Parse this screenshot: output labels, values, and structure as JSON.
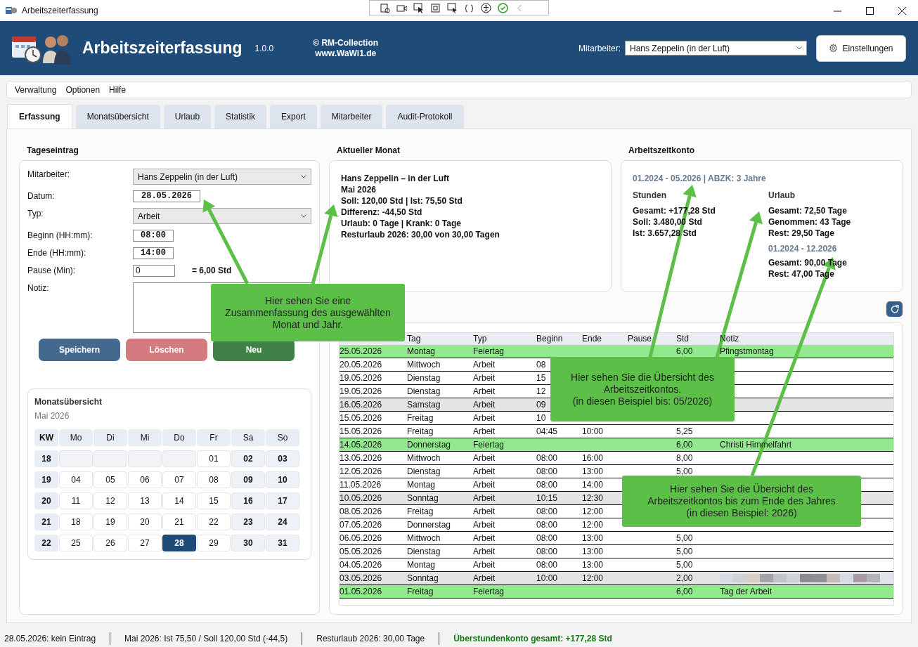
{
  "window": {
    "title": "Arbeitszeiterfassung"
  },
  "header": {
    "app_name": "Arbeitszeiterfassung",
    "version": "1.0.0",
    "copyright": "© RM-Collection",
    "website": "www.WaWi1.de",
    "employee_label": "Mitarbeiter:",
    "employee_value": "Hans Zeppelin (in der Luft)",
    "settings_button": "Einstellungen"
  },
  "menu": [
    "Verwaltung",
    "Optionen",
    "Hilfe"
  ],
  "tabs": [
    {
      "label": "Erfassung",
      "selected": true
    },
    {
      "label": "Monatsübersicht",
      "selected": false
    },
    {
      "label": "Urlaub",
      "selected": false
    },
    {
      "label": "Statistik",
      "selected": false
    },
    {
      "label": "Export",
      "selected": false
    },
    {
      "label": "Mitarbeiter",
      "selected": false
    },
    {
      "label": "Audit-Protokoll",
      "selected": false
    }
  ],
  "entry": {
    "title": "Tageseintrag",
    "fields": [
      {
        "kind": "select",
        "label": "Mitarbeiter:",
        "value": "Hans Zeppelin (in der Luft)"
      },
      {
        "kind": "date",
        "label": "Datum:",
        "value": "28.05.2026"
      },
      {
        "kind": "select",
        "label": "Typ:",
        "value": "Arbeit"
      },
      {
        "kind": "time",
        "label": "Beginn (HH:mm):",
        "value": "08:00"
      },
      {
        "kind": "time",
        "label": "Ende (HH:mm):",
        "value": "14:00"
      },
      {
        "kind": "number",
        "label": "Pause (Min):",
        "value": "0",
        "result": "= 6,00 Std"
      },
      {
        "kind": "textarea",
        "label": "Notiz:"
      }
    ],
    "buttons": [
      {
        "label": "Speichern",
        "kind": "primary",
        "disabled": false
      },
      {
        "label": "Löschen",
        "kind": "danger",
        "disabled": true
      },
      {
        "label": "Neu",
        "kind": "success",
        "disabled": false
      }
    ]
  },
  "calendar": {
    "title": "Monatsübersicht",
    "month": "Mai 2026",
    "week_header": "KW",
    "day_headers": [
      "Mo",
      "Di",
      "Mi",
      "Do",
      "Fr",
      "Sa",
      "So"
    ],
    "weeks": [
      {
        "kw": "18",
        "days": [
          {
            "kind": "empty"
          },
          {
            "kind": "empty"
          },
          {
            "kind": "empty"
          },
          {
            "kind": "empty"
          },
          {
            "day": "01",
            "kind": "weekday",
            "selected": false
          },
          {
            "day": "02",
            "kind": "weekend",
            "selected": false
          },
          {
            "day": "03",
            "kind": "weekend",
            "selected": false
          }
        ]
      },
      {
        "kw": "19",
        "days": [
          {
            "day": "04",
            "kind": "weekday",
            "selected": false
          },
          {
            "day": "05",
            "kind": "weekday",
            "selected": false
          },
          {
            "day": "06",
            "kind": "weekday",
            "selected": false
          },
          {
            "day": "07",
            "kind": "weekday",
            "selected": false
          },
          {
            "day": "08",
            "kind": "weekday",
            "selected": false
          },
          {
            "day": "09",
            "kind": "weekend",
            "selected": false
          },
          {
            "day": "10",
            "kind": "weekend",
            "selected": false
          }
        ]
      },
      {
        "kw": "20",
        "days": [
          {
            "day": "11",
            "kind": "weekday",
            "selected": false
          },
          {
            "day": "12",
            "kind": "weekday",
            "selected": false
          },
          {
            "day": "13",
            "kind": "weekday",
            "selected": false
          },
          {
            "day": "14",
            "kind": "weekday",
            "selected": false
          },
          {
            "day": "15",
            "kind": "weekday",
            "selected": false
          },
          {
            "day": "16",
            "kind": "weekend",
            "selected": false
          },
          {
            "day": "17",
            "kind": "weekend",
            "selected": false
          }
        ]
      },
      {
        "kw": "21",
        "days": [
          {
            "day": "18",
            "kind": "weekday",
            "selected": false
          },
          {
            "day": "19",
            "kind": "weekday",
            "selected": false
          },
          {
            "day": "20",
            "kind": "weekday",
            "selected": false
          },
          {
            "day": "21",
            "kind": "weekday",
            "selected": false
          },
          {
            "day": "22",
            "kind": "weekday",
            "selected": false
          },
          {
            "day": "23",
            "kind": "weekend",
            "selected": false
          },
          {
            "day": "24",
            "kind": "weekend",
            "selected": false
          }
        ]
      },
      {
        "kw": "22",
        "days": [
          {
            "day": "25",
            "kind": "weekday",
            "selected": false
          },
          {
            "day": "26",
            "kind": "weekday",
            "selected": false
          },
          {
            "day": "27",
            "kind": "weekday",
            "selected": false
          },
          {
            "day": "28",
            "kind": "weekday",
            "selected": true
          },
          {
            "day": "29",
            "kind": "weekday",
            "selected": false
          },
          {
            "day": "30",
            "kind": "weekend",
            "selected": false
          },
          {
            "day": "31",
            "kind": "weekend",
            "selected": false
          }
        ]
      }
    ]
  },
  "month_summary": {
    "title": "Aktueller Monat",
    "lines": [
      "Hans Zeppelin – in der Luft",
      "Mai 2026",
      "Soll: 120,00 Std  |  Ist: 75,50 Std",
      "Differenz: -44,50 Std",
      "Urlaub: 0 Tage  |  Krank: 0 Tage",
      "Resturlaub 2026: 30,00 von 30,00 Tagen"
    ]
  },
  "account": {
    "title": "Arbeitszeitkonto",
    "period": "01.2024 - 05.2026  |  ABZK: 3 Jahre",
    "hours": {
      "title": "Stunden",
      "lines": [
        "Gesamt: +177,28 Std",
        "Soll: 3.480,00 Std",
        "Ist: 3.657,28 Std"
      ]
    },
    "vacation": {
      "title": "Urlaub",
      "lines": [
        "Gesamt: 72,50 Tage",
        "Genommen: 43 Tage",
        "Rest: 29,50 Tage"
      ],
      "year_period": "01.2024 - 12.2026",
      "year_lines": [
        "Gesamt: 90,00 Tage",
        "Rest: 47,00 Tage"
      ]
    }
  },
  "table": {
    "columns": [
      "Tag",
      "Typ",
      "Beginn",
      "Ende",
      "Pause",
      "Std",
      "Notiz"
    ],
    "rows": [
      {
        "kind": "holiday",
        "date": "25.05.2026",
        "day": "Montag",
        "type": "Feiertag",
        "hours": "6,00",
        "note": "Pfingstmontag"
      },
      {
        "kind": "work",
        "date": "20.05.2026",
        "day": "Mittwoch",
        "type": "Arbeit",
        "begin": "08"
      },
      {
        "kind": "work",
        "date": "19.05.2026",
        "day": "Dienstag",
        "type": "Arbeit",
        "begin": "15"
      },
      {
        "kind": "work",
        "date": "19.05.2026",
        "day": "Dienstag",
        "type": "Arbeit",
        "begin": "12"
      },
      {
        "kind": "weekend",
        "date": "16.05.2026",
        "day": "Samstag",
        "type": "Arbeit",
        "begin": "09"
      },
      {
        "kind": "work",
        "date": "15.05.2026",
        "day": "Freitag",
        "type": "Arbeit",
        "begin": "10"
      },
      {
        "kind": "work",
        "date": "15.05.2026",
        "day": "Freitag",
        "type": "Arbeit",
        "begin": "04:45",
        "end": "10:00",
        "hours": "5,25"
      },
      {
        "kind": "holiday",
        "date": "14.05.2026",
        "day": "Donnerstag",
        "type": "Feiertag",
        "hours": "6,00",
        "note": "Christi Himmelfahrt"
      },
      {
        "kind": "work",
        "date": "13.05.2026",
        "day": "Mittwoch",
        "type": "Arbeit",
        "begin": "08:00",
        "end": "16:00",
        "hours": "8,00"
      },
      {
        "kind": "work",
        "date": "12.05.2026",
        "day": "Dienstag",
        "type": "Arbeit",
        "begin": "08:00",
        "end": "13:00",
        "hours": "5,00"
      },
      {
        "kind": "work",
        "date": "11.05.2026",
        "day": "Montag",
        "type": "Arbeit",
        "begin": "08:00",
        "end": "14:00"
      },
      {
        "kind": "weekend",
        "date": "10.05.2026",
        "day": "Sonntag",
        "type": "Arbeit",
        "begin": "10:15",
        "end": "12:30"
      },
      {
        "kind": "work",
        "date": "08.05.2026",
        "day": "Freitag",
        "type": "Arbeit",
        "begin": "08:00",
        "end": "12:00"
      },
      {
        "kind": "work",
        "date": "07.05.2026",
        "day": "Donnerstag",
        "type": "Arbeit",
        "begin": "08:00",
        "end": "12:00"
      },
      {
        "kind": "work",
        "date": "06.05.2026",
        "day": "Mittwoch",
        "type": "Arbeit",
        "begin": "08:00",
        "end": "13:00",
        "hours": "5,00"
      },
      {
        "kind": "work",
        "date": "05.05.2026",
        "day": "Dienstag",
        "type": "Arbeit",
        "begin": "08:00",
        "end": "13:00",
        "hours": "5,00"
      },
      {
        "kind": "work",
        "date": "04.05.2026",
        "day": "Montag",
        "type": "Arbeit",
        "begin": "08:00",
        "end": "13:00",
        "hours": "5,00"
      },
      {
        "kind": "weekend",
        "date": "03.05.2026",
        "day": "Sonntag",
        "type": "Arbeit",
        "begin": "10:00",
        "end": "12:00",
        "hours": "2,00",
        "redacted": true
      },
      {
        "kind": "holiday",
        "date": "01.05.2026",
        "day": "Freitag",
        "type": "Feiertag",
        "hours": "6,00",
        "note": "Tag der Arbeit"
      }
    ]
  },
  "callouts": [
    {
      "lines": [
        "Hier sehen Sie eine",
        "Zusammenfassung des ausgewählten",
        "Monat und Jahr."
      ]
    },
    {
      "lines": [
        "Hier sehen Sie die Übersicht des",
        "Arbeitszeitkontos.",
        "(in diesen Beispiel bis: 05/2026)"
      ]
    },
    {
      "lines": [
        "Hier sehen Sie die Übersicht des",
        "Arbeitszeitkontos bis zum Ende des Jahres",
        "(in diesen Beispiel: 2026)"
      ]
    }
  ],
  "status_bar": [
    {
      "text": "28.05.2026: kein Eintrag",
      "kind": "normal"
    },
    {
      "text": "Mai 2026: Ist 75,50 / Soll 120,00 Std (-44,5)",
      "kind": "normal"
    },
    {
      "text": "Resturlaub 2026: 30,00 Tage",
      "kind": "normal"
    },
    {
      "text": "Überstundenkonto gesamt: +177,28 Std",
      "kind": "highlight"
    }
  ]
}
